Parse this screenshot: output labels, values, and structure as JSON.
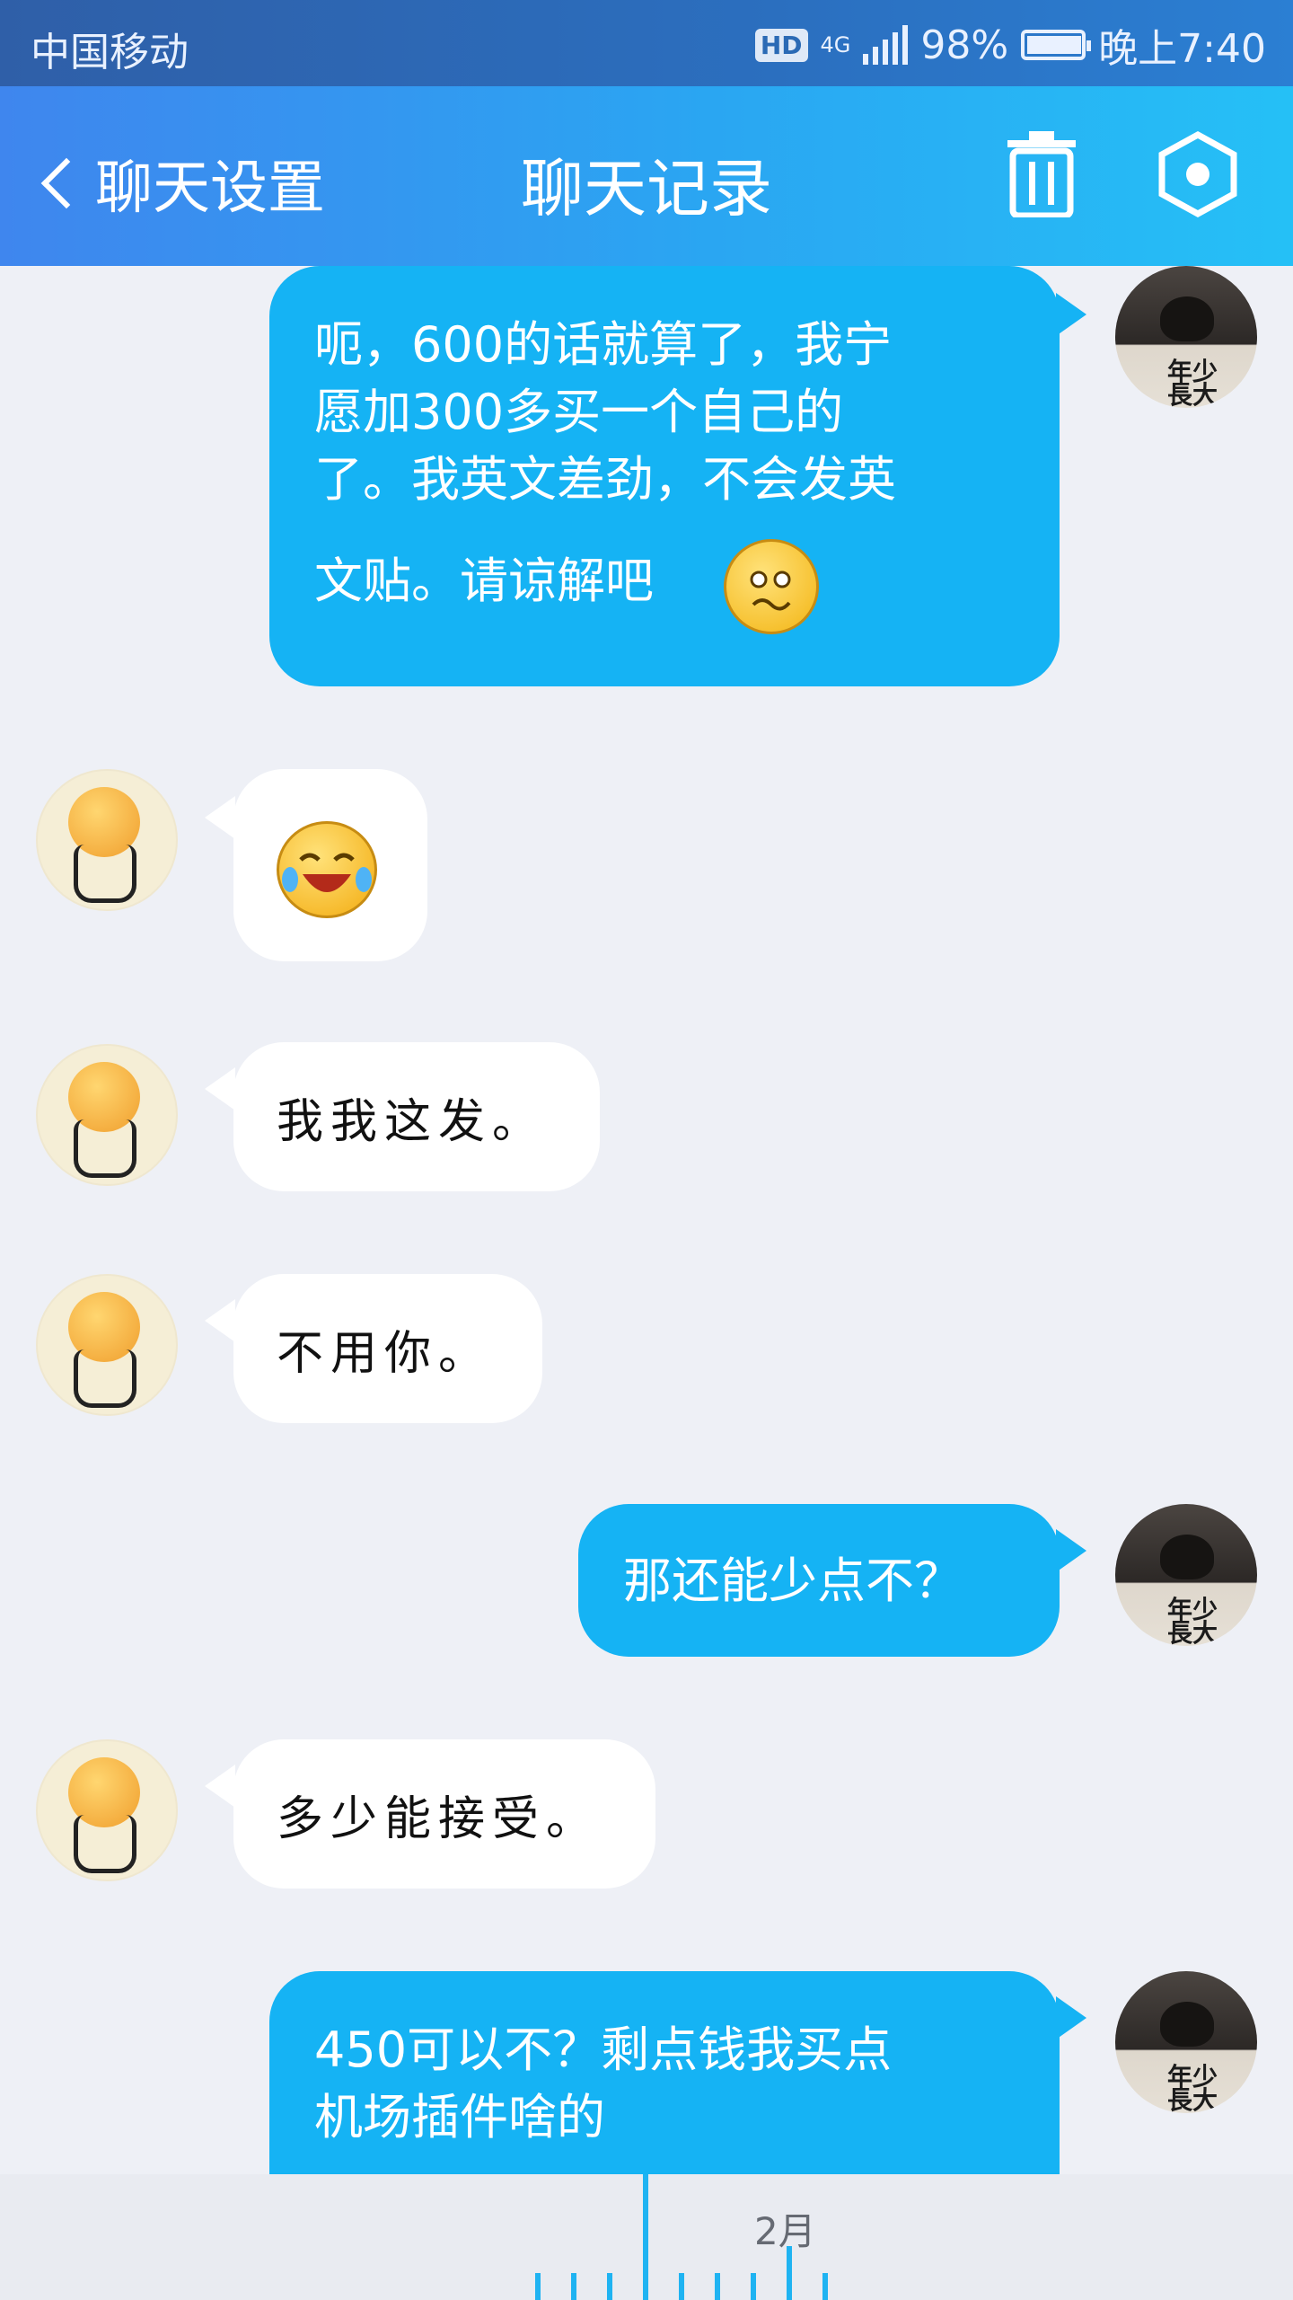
{
  "status_bar": {
    "carrier": "中国移动",
    "hd": "HD",
    "network": "4G",
    "battery": "98%",
    "battery_level": 0.98,
    "time": "晚上7:40"
  },
  "nav": {
    "back_label": "聊天设置",
    "title": "聊天记录",
    "icons": [
      "trash-icon",
      "hexagon-settings-icon"
    ]
  },
  "avatars": {
    "me_text": [
      "年少",
      "長大"
    ]
  },
  "messages": [
    {
      "side": "sent",
      "lines": [
        "呃，600的话就算了，我宁",
        "愿加300多买一个自己的",
        "了。我英文差劲，不会发英",
        "文贴。请谅解吧"
      ],
      "emoji": "worried-face-emoji"
    },
    {
      "side": "recv",
      "emoji": "tears-of-joy-emoji"
    },
    {
      "side": "recv",
      "text": "我我这发。"
    },
    {
      "side": "recv",
      "text": "不用你。"
    },
    {
      "side": "sent",
      "text": "那还能少点不？"
    },
    {
      "side": "recv",
      "text": "多少能接受。"
    },
    {
      "side": "sent",
      "lines": [
        "450可以不？剩点钱我买点",
        "机场插件啥的"
      ]
    }
  ],
  "timeline": {
    "month_label": "2月"
  },
  "colors": {
    "sent_bubble": "#15b3f4",
    "recv_bubble": "#ffffff",
    "background": "#eef0f6",
    "nav_gradient_start": "#3f86ee",
    "nav_gradient_end": "#25c0f6"
  }
}
